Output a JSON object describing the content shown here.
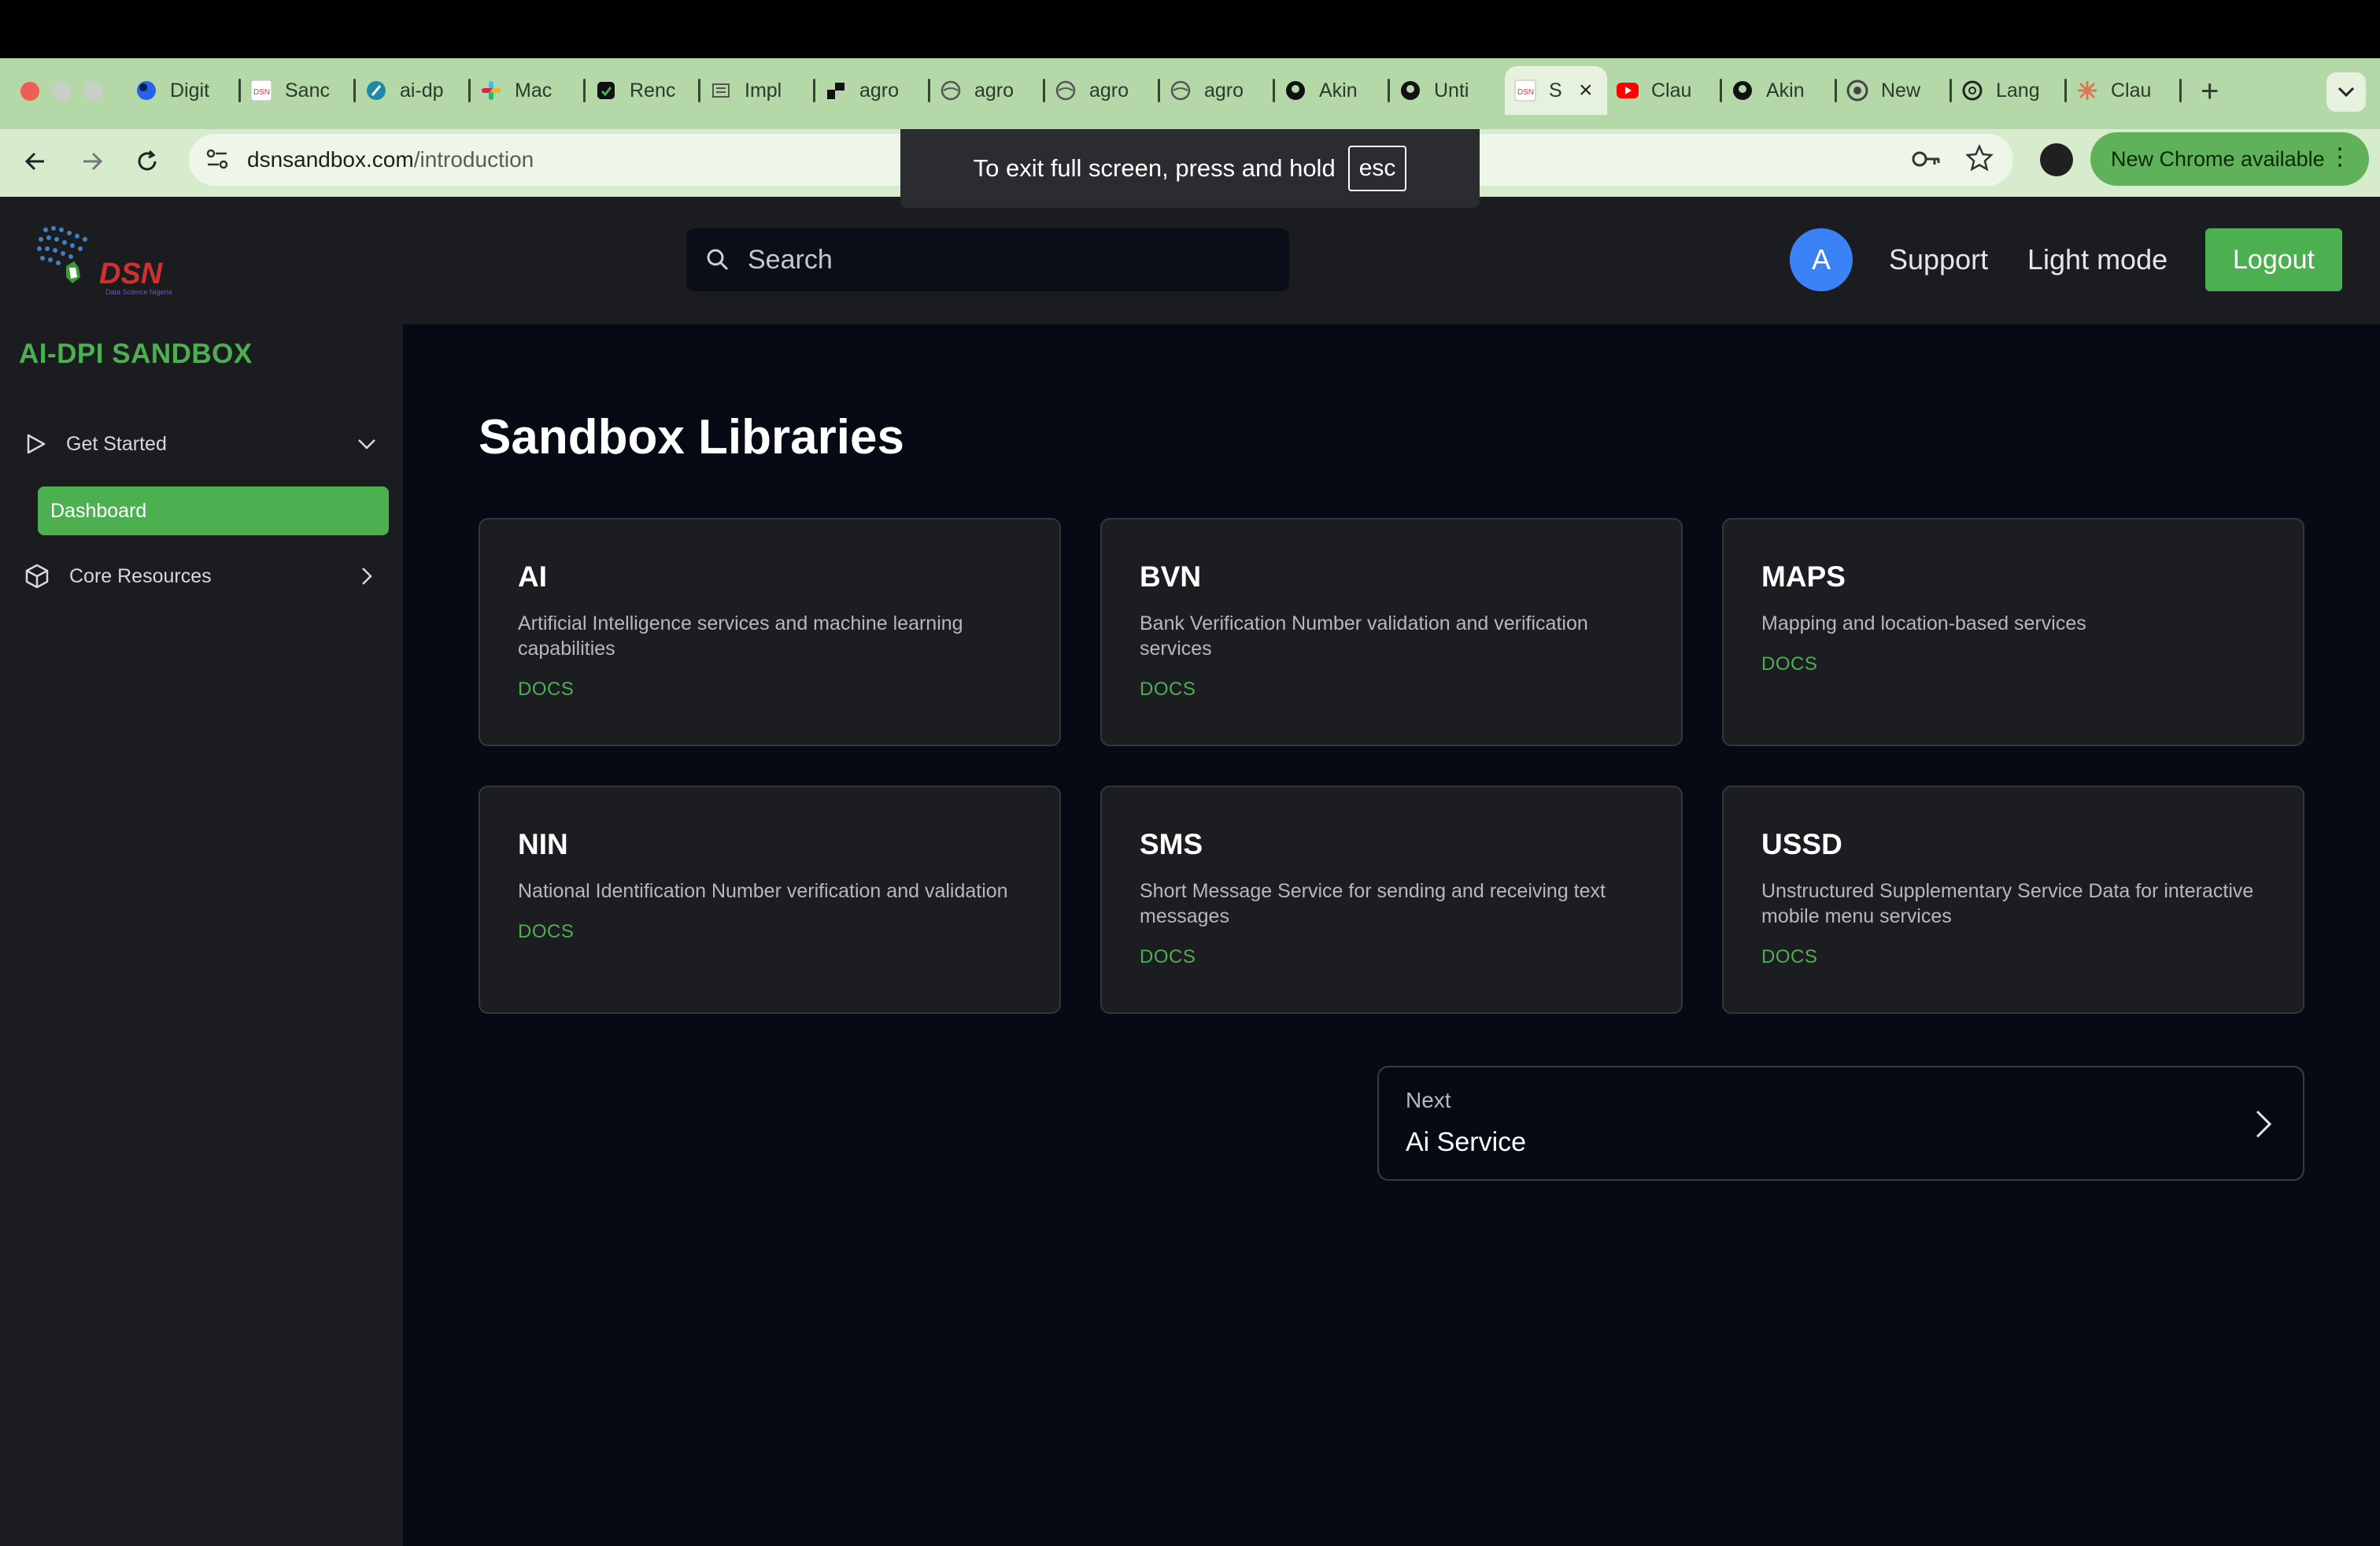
{
  "browser": {
    "tabs": [
      {
        "title": "Digit",
        "icon": "blue-circle-icon",
        "color": "#2563eb"
      },
      {
        "title": "Sanc",
        "icon": "dsn-favicon-icon",
        "color": "#d33"
      },
      {
        "title": "ai-dр",
        "icon": "feather-icon",
        "color": "#1f8aa8"
      },
      {
        "title": "Mac",
        "icon": "slack-icon",
        "color": "#e01e5a"
      },
      {
        "title": "Renc",
        "icon": "render-icon",
        "color": "#111"
      },
      {
        "title": "Impl",
        "icon": "doc-icon",
        "color": "#555"
      },
      {
        "title": "agro",
        "icon": "agro-icon",
        "color": "#111"
      },
      {
        "title": "agro",
        "icon": "globe-icon",
        "color": "#555"
      },
      {
        "title": "agro",
        "icon": "globe-icon",
        "color": "#555"
      },
      {
        "title": "agro",
        "icon": "globe-icon",
        "color": "#555"
      },
      {
        "title": "Akin",
        "icon": "github-icon",
        "color": "#111"
      },
      {
        "title": "Unti",
        "icon": "github-icon",
        "color": "#111"
      },
      {
        "title": "S",
        "icon": "dsn-favicon-icon",
        "color": "#d33",
        "active": true
      },
      {
        "title": "Clau",
        "icon": "youtube-icon",
        "color": "#ff0000"
      },
      {
        "title": "Akin",
        "icon": "github-icon",
        "color": "#111"
      },
      {
        "title": "New",
        "icon": "chrome-icon",
        "color": "#555"
      },
      {
        "title": "Lang",
        "icon": "openai-icon",
        "color": "#111"
      },
      {
        "title": "Clau",
        "icon": "claude-icon",
        "color": "#d97757"
      }
    ],
    "url_host": "dsnsandbox.com",
    "url_path": "/introduction",
    "update_label": "New Chrome available",
    "fullscreen_notice": "To exit full screen, press and hold",
    "fullscreen_key": "esc"
  },
  "header": {
    "logo_text": "DSN",
    "logo_sub": "Data Science Nigeria",
    "search_placeholder": "Search",
    "avatar_letter": "A",
    "support": "Support",
    "theme_toggle": "Light mode",
    "logout": "Logout"
  },
  "sidebar": {
    "brand": "AI-DPI SANDBOX",
    "get_started": "Get Started",
    "dashboard": "Dashboard",
    "core_resources": "Core Resources"
  },
  "main": {
    "title": "Sandbox Libraries",
    "cards": [
      {
        "name": "AI",
        "desc": "Artificial Intelligence services and machine learning capabilities",
        "link": "DOCS"
      },
      {
        "name": "BVN",
        "desc": "Bank Verification Number validation and verification services",
        "link": "DOCS"
      },
      {
        "name": "MAPS",
        "desc": "Mapping and location-based services",
        "link": "DOCS"
      },
      {
        "name": "NIN",
        "desc": "National Identification Number verification and validation",
        "link": "DOCS"
      },
      {
        "name": "SMS",
        "desc": "Short Message Service for sending and receiving text messages",
        "link": "DOCS"
      },
      {
        "name": "USSD",
        "desc": "Unstructured Supplementary Service Data for interactive mobile menu services",
        "link": "DOCS"
      }
    ],
    "next_label": "Next",
    "next_target": "Ai Service"
  },
  "colors": {
    "accent": "#4caf50",
    "avatar": "#3b82f6",
    "page_bg": "#050a15",
    "panel_bg": "#1b1c20"
  }
}
